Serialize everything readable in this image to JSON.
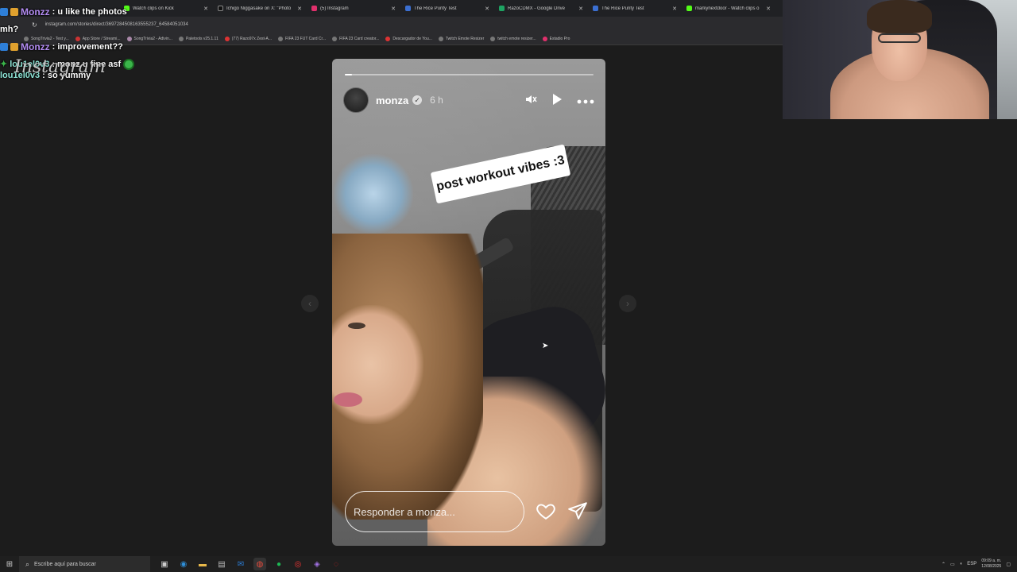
{
  "browser": {
    "tabs": [
      {
        "title": "Watch clips on Kick",
        "color": "#53fc18"
      },
      {
        "title": "Ichigo Niggasake on X: \"Photo",
        "color": "#111111"
      },
      {
        "title": "(5) Instagram",
        "color": "#e1306c"
      },
      {
        "title": "The Rice Purity Test",
        "color": "#3b6fd1"
      },
      {
        "title": "RazoCDMX - Google Drive",
        "color": "#1ea362"
      },
      {
        "title": "The Rice Purity Test",
        "color": "#3b6fd1"
      },
      {
        "title": "markynextdoor - Watch clips o",
        "color": "#53fc18"
      }
    ],
    "url": "instagram.com/stories/direct/3697284508163555237_64584051034",
    "bookmarks": [
      "SongTrivia2 - Test y...",
      "App Store / Streami...",
      "SongTrivia2 - Adivin...",
      "Paletools v25.1.11",
      "(77) Razo97x Zest-A...",
      "FIFA 23 FUT Card Cr...",
      "FIFA 23 Card creator...",
      "Descargador de You...",
      "Twitch Emote Resizer",
      "twitch emote resizer...",
      "Estadio Pro"
    ]
  },
  "chat": {
    "messages": [
      {
        "user": "Monzz",
        "text": ": u like the photos",
        "user_color": "#b38cf2"
      },
      {
        "user": "mh?",
        "text": "",
        "user_color": "#ffffff"
      },
      {
        "user": "Monzz",
        "text": ": improvement??",
        "user_color": "#b38cf2"
      },
      {
        "user": "lou1el0v3",
        "text": ": monz u fine asf",
        "user_color": "#8ee6d8"
      },
      {
        "user": "lou1el0v3",
        "text": ": so yummy",
        "user_color": "#8ee6d8"
      }
    ],
    "watermark": "Instagram"
  },
  "story": {
    "username": "monza",
    "verified": true,
    "time": "6 h",
    "progress": 0.03,
    "sticker_text": "post workout vibes :3",
    "reply_placeholder": "Responder a monza...",
    "icons": {
      "mute": "speaker-icon",
      "play": "play-icon",
      "more": "more-icon",
      "like": "heart-icon",
      "send": "send-icon"
    }
  },
  "taskbar": {
    "search_placeholder": "Escribe aquí para buscar",
    "lang": "ESP",
    "time": "09:09 a. m.",
    "date": "12/08/2025"
  }
}
